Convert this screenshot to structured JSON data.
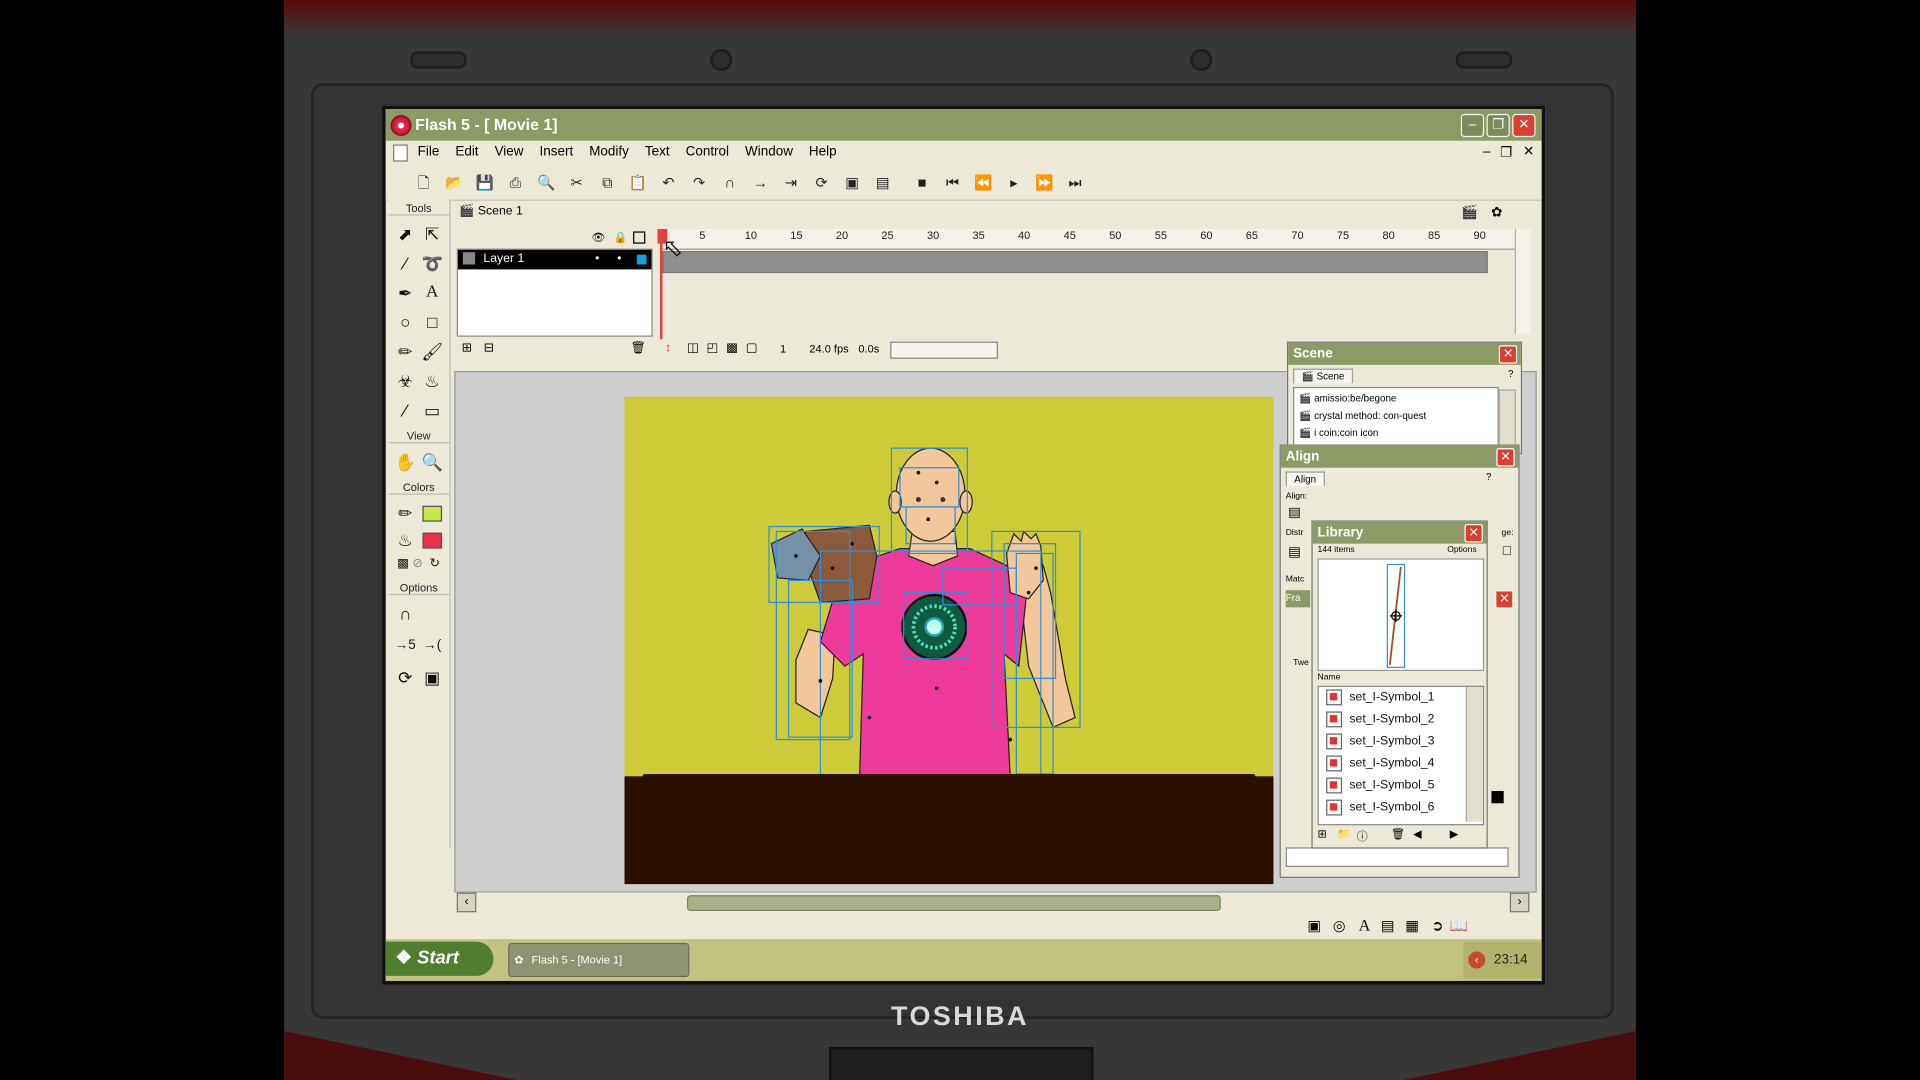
{
  "window": {
    "title": "Flash 5 - [ Movie 1]",
    "brand": "TOSHIBA"
  },
  "menu": [
    "File",
    "Edit",
    "View",
    "Insert",
    "Modify",
    "Text",
    "Control",
    "Window",
    "Help"
  ],
  "toolbar_icons": [
    "new-icon",
    "open-icon",
    "save-icon",
    "print-icon",
    "print-preview-icon",
    "cut-icon",
    "copy-icon",
    "paste-icon",
    "undo-icon",
    "redo-icon",
    "snap-magnet-icon",
    "smooth-icon",
    "straighten-icon",
    "rotate-icon",
    "scale-icon",
    "align-icon"
  ],
  "playback_icons": [
    "stop-icon",
    "rewind-icon",
    "step-back-icon",
    "play-icon",
    "step-forward-icon",
    "go-to-end-icon"
  ],
  "tools": {
    "header": "Tools",
    "view_header": "View",
    "colors_header": "Colors",
    "options_header": "Options",
    "stroke_color": "#c8e84a",
    "fill_color": "#e8304a"
  },
  "timeline": {
    "scene_label": "Scene 1",
    "layer_name": "Layer 1",
    "ruler_ticks": [
      "5",
      "10",
      "15",
      "20",
      "25",
      "30",
      "35",
      "40",
      "45",
      "50",
      "55",
      "60",
      "65",
      "70",
      "75",
      "80",
      "85",
      "90"
    ],
    "current_frame": "1",
    "frame_rate": "24.0 fps",
    "elapsed": "0.0s"
  },
  "scene_panel": {
    "title": "Scene",
    "tab": "Scene",
    "items": [
      "amissio:be/begone",
      "crystal method: con-quest",
      "i coin:coin icon"
    ]
  },
  "align_panel": {
    "title": "Align",
    "tab": "Align",
    "align_label": "Align:",
    "distribute_label": "Distr",
    "match_label": "Matc",
    "size_label": "ge:",
    "frame_tab_fragment": "Fra",
    "tween_label": "Twe"
  },
  "library_panel": {
    "title": "Library",
    "count": "144 items",
    "options": "Options",
    "name_header": "Name",
    "items": [
      "set_I-Symbol_1",
      "set_I-Symbol_2",
      "set_I-Symbol_3",
      "set_I-Symbol_4",
      "set_I-Symbol_5",
      "set_I-Symbol_6"
    ]
  },
  "taskbar": {
    "start": "Start",
    "task": "Flash 5 - [Movie 1]",
    "clock": "23:14"
  },
  "colors": {
    "stage": "#cdcc38",
    "shirt": "#ee3a9a",
    "skin": "#f3c79a",
    "table": "#2a1000",
    "selection": "#2f8fd8",
    "titlebar": "#8c9b66"
  }
}
